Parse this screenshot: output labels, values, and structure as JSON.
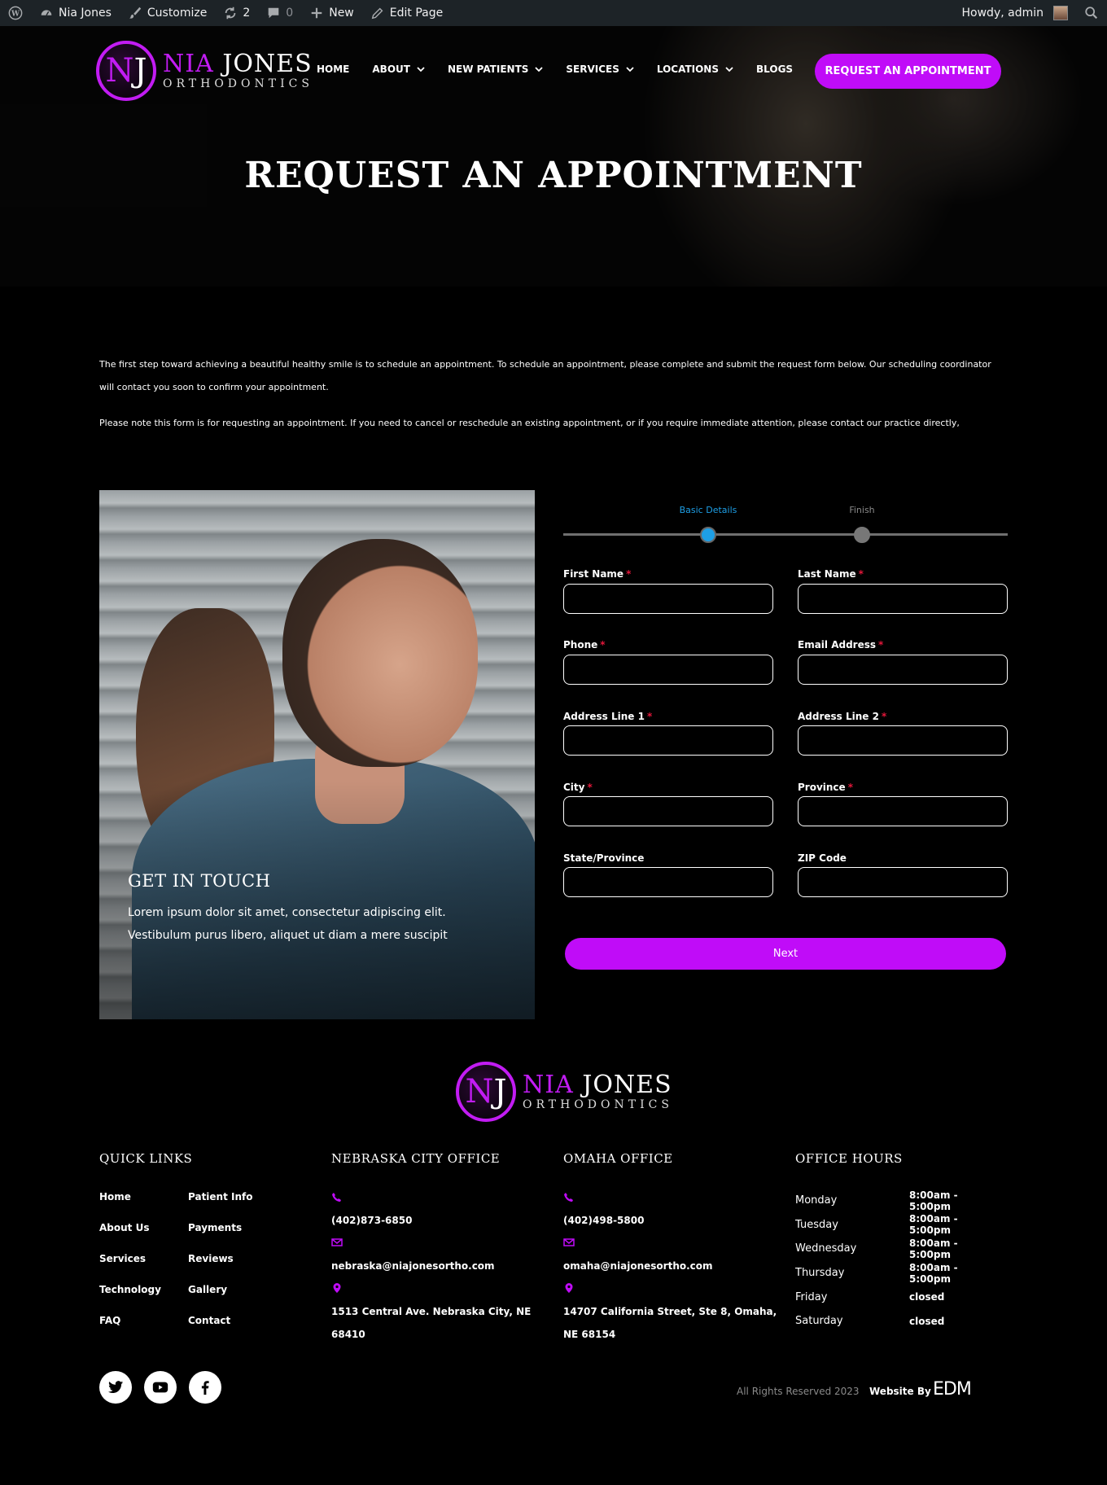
{
  "admin_bar": {
    "site_name": "Nia Jones",
    "customize": "Customize",
    "updates_count": "2",
    "comments_count": "0",
    "new_label": "New",
    "edit_label": "Edit Page",
    "greeting": "Howdy, admin"
  },
  "header": {
    "logo_name_first": "NIA",
    "logo_name_last": "JONES",
    "logo_sub": "ORTHODONTICS",
    "nav": [
      {
        "label": "HOME",
        "has_dropdown": false
      },
      {
        "label": "ABOUT",
        "has_dropdown": true
      },
      {
        "label": "NEW PATIENTS",
        "has_dropdown": true
      },
      {
        "label": "SERVICES",
        "has_dropdown": true
      },
      {
        "label": "LOCATIONS",
        "has_dropdown": true
      },
      {
        "label": "BLOGS",
        "has_dropdown": false
      }
    ],
    "cta": "REQUEST AN APPOINTMENT"
  },
  "hero": {
    "title": "REQUEST AN APPOINTMENT"
  },
  "intro": {
    "p1": "The first step toward achieving a beautiful healthy smile is to schedule an appointment. To schedule an appointment, please complete and submit the request form below. Our scheduling coordinator will contact you soon to confirm your appointment.",
    "p2": "Please note this form is for requesting an appointment. If you need to cancel or reschedule an existing appointment, or if you require immediate attention, please contact our practice directly,"
  },
  "get_in_touch": {
    "title": "GET IN TOUCH",
    "text": "Lorem ipsum dolor sit amet, consectetur adipiscing elit. Vestibulum purus libero, aliquet ut diam a mere suscipit"
  },
  "steps": {
    "items": [
      "Basic Details",
      "Finish"
    ],
    "active_color": "#1e9fe6",
    "inactive_color": "#8a8a8a"
  },
  "form": {
    "fields": [
      {
        "label": "First Name",
        "required": true,
        "value": ""
      },
      {
        "label": "Last Name",
        "required": true,
        "value": ""
      },
      {
        "label": "Phone",
        "required": true,
        "value": ""
      },
      {
        "label": "Email Address",
        "required": true,
        "value": ""
      },
      {
        "label": "Address Line 1",
        "required": true,
        "value": ""
      },
      {
        "label": "Address Line 2",
        "required": true,
        "value": ""
      },
      {
        "label": "City",
        "required": true,
        "value": ""
      },
      {
        "label": "Province",
        "required": true,
        "value": ""
      },
      {
        "label": "State/Province",
        "required": false,
        "value": ""
      },
      {
        "label": "ZIP Code",
        "required": false,
        "value": ""
      }
    ],
    "required_mark": "*",
    "next_label": "Next"
  },
  "footer": {
    "quick_links_title": "QUICK LINKS",
    "quick_links": [
      "Home",
      "Patient Info",
      "About Us",
      "Payments",
      "Services",
      "Reviews",
      "Technology",
      "Gallery",
      "FAQ",
      "Contact"
    ],
    "nebraska": {
      "title": "NEBRASKA CITY OFFICE",
      "phone": "(402)873-6850",
      "email": "nebraska@niajonesortho.com",
      "address": "1513 Central Ave. Nebraska City, NE 68410"
    },
    "omaha": {
      "title": "OMAHA OFFICE",
      "phone": "(402)498-5800",
      "email": "omaha@niajonesortho.com",
      "address": "14707 California Street, Ste 8, Omaha, NE 68154"
    },
    "hours_title": "OFFICE HOURS",
    "hours": [
      {
        "day": "Monday",
        "time": "8:00am - 5:00pm"
      },
      {
        "day": "Tuesday",
        "time": "8:00am - 5:00pm"
      },
      {
        "day": "Wednesday",
        "time": "8:00am - 5:00pm"
      },
      {
        "day": "Thursday",
        "time": "8:00am - 5:00pm"
      },
      {
        "day": "Friday",
        "time": "closed"
      },
      {
        "day": "Saturday",
        "time": "closed"
      }
    ],
    "social": [
      "twitter-icon",
      "youtube-icon",
      "facebook-icon"
    ],
    "rights": "All Rights Reserved 2023",
    "website_by": "Website By",
    "agency": "EDM"
  },
  "colors": {
    "accent": "#c00cf8",
    "bg": "#000000",
    "adminbar": "#1d2327",
    "required": "#e3173a"
  }
}
